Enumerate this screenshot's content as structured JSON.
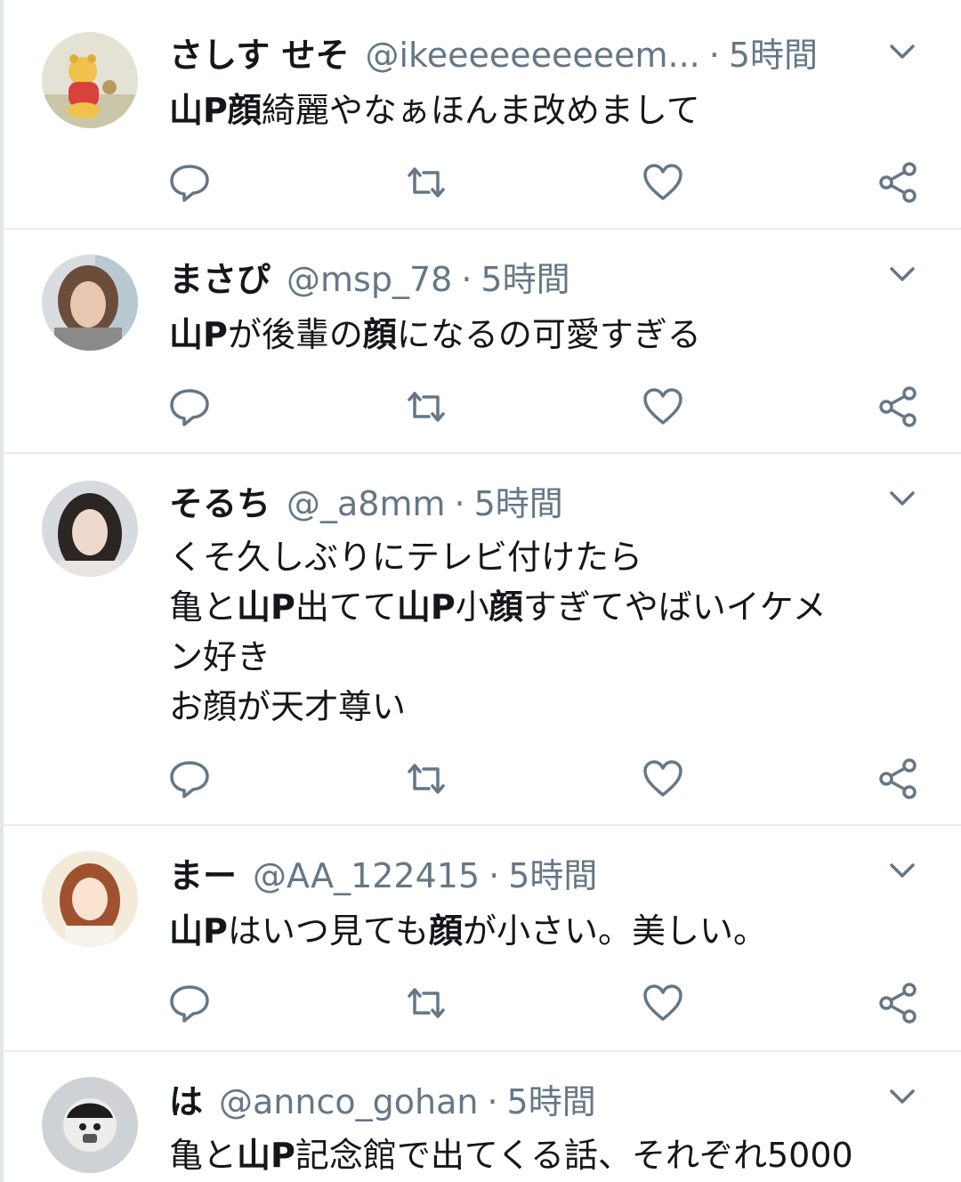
{
  "tweets": [
    {
      "name": "さしす せそ",
      "handle": "@ikeeeeeeeeeem...",
      "sep": "·",
      "time": "5時間",
      "lines": [
        [
          {
            "t": "山P顔",
            "b": true
          },
          {
            "t": "綺麗やなぁほんま改めまして",
            "b": false
          }
        ]
      ]
    },
    {
      "name": "まさぴ",
      "handle": "@msp_78",
      "sep": "·",
      "time": "5時間",
      "lines": [
        [
          {
            "t": "山P",
            "b": true
          },
          {
            "t": "が後輩の",
            "b": false
          },
          {
            "t": "顔",
            "b": true
          },
          {
            "t": "になるの可愛すぎる",
            "b": false
          }
        ]
      ]
    },
    {
      "name": "そるち",
      "handle": "@_a8mm",
      "sep": "·",
      "time": "5時間",
      "lines": [
        [
          {
            "t": "くそ久しぶりにテレビ付けたら",
            "b": false
          }
        ],
        [
          {
            "t": "亀と",
            "b": false
          },
          {
            "t": "山P",
            "b": true
          },
          {
            "t": "出てて",
            "b": false
          },
          {
            "t": "山P",
            "b": true
          },
          {
            "t": "小",
            "b": false
          },
          {
            "t": "顔",
            "b": true
          },
          {
            "t": "すぎてやばいイケメ",
            "b": false
          }
        ],
        [
          {
            "t": "ン好き",
            "b": false
          }
        ],
        [
          {
            "t": "お顔が天才尊い",
            "b": false
          }
        ]
      ]
    },
    {
      "name": "まー",
      "handle": "@AA_122415",
      "sep": "·",
      "time": "5時間",
      "lines": [
        [
          {
            "t": "山P",
            "b": true
          },
          {
            "t": "はいつ見ても",
            "b": false
          },
          {
            "t": "顔",
            "b": true
          },
          {
            "t": "が小さい。美しい。",
            "b": false
          }
        ]
      ]
    },
    {
      "name": "は",
      "handle": "@annco_gohan",
      "sep": "·",
      "time": "5時間",
      "lines": [
        [
          {
            "t": "亀と",
            "b": false
          },
          {
            "t": "山P",
            "b": true
          },
          {
            "t": "記念館で出てくる話、それぞれ5000",
            "b": false
          }
        ]
      ]
    }
  ],
  "colors": {
    "text": "#14171a",
    "secondary": "#657786",
    "icon": "#657786",
    "divider": "#e6ecf0"
  },
  "icons": [
    "reply-icon",
    "retweet-icon",
    "like-icon",
    "share-icon",
    "chevron-down-icon"
  ]
}
